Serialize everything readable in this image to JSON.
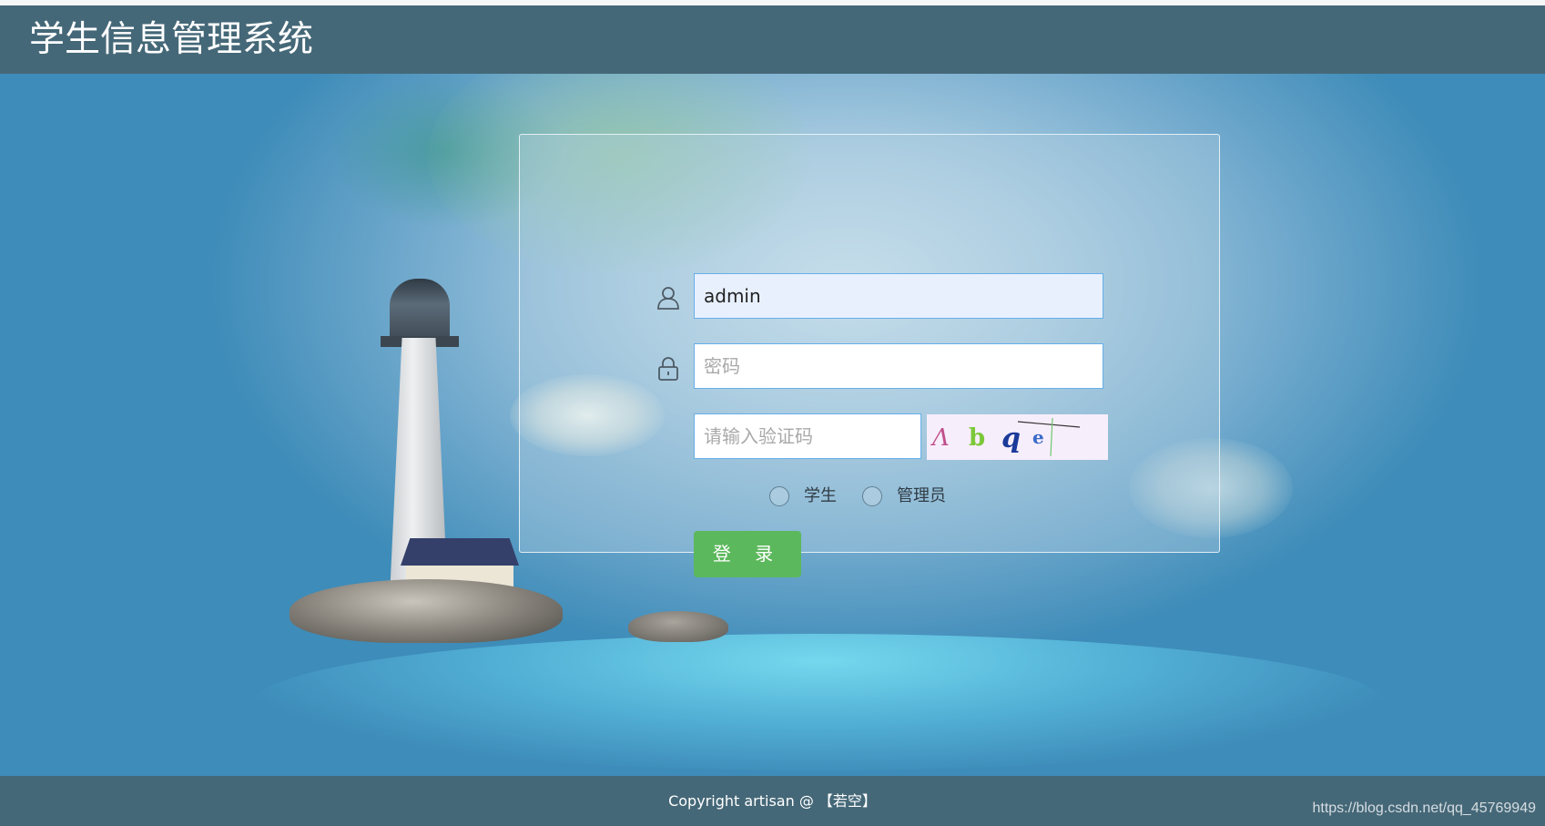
{
  "header": {
    "title": "学生信息管理系统"
  },
  "login_form": {
    "username": {
      "value": "admin",
      "icon": "user-icon"
    },
    "password": {
      "placeholder": "密码",
      "icon": "lock-icon"
    },
    "captcha": {
      "placeholder": "请输入验证码",
      "image_text": "Λbqe"
    },
    "roles": [
      {
        "label": "学生",
        "selected": false
      },
      {
        "label": "管理员",
        "selected": false
      }
    ],
    "submit_label": "登 录"
  },
  "footer": {
    "copyright": "Copyright  artisan @ 【若空】",
    "watermark": "https://blog.csdn.net/qq_45769949"
  },
  "colors": {
    "header_bg": "#456878",
    "login_button": "#5cb85c",
    "input_focus_border": "#66afe9"
  }
}
